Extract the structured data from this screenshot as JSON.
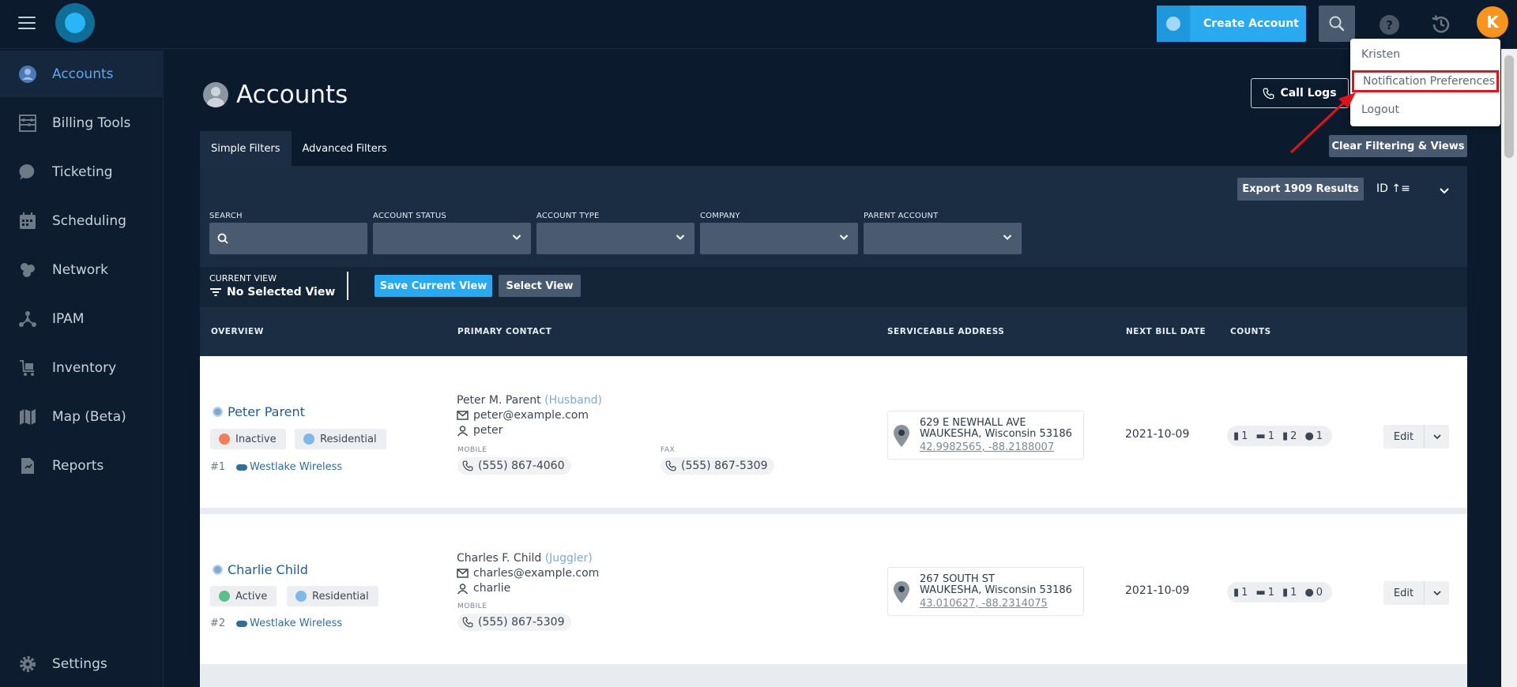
{
  "topbar": {
    "create_account_label": "Create Account",
    "help_label": "?",
    "avatar_initial": "K"
  },
  "user_menu": {
    "items": [
      "Kristen",
      "Notification Preferences",
      "Logout"
    ]
  },
  "sidebar": {
    "items": [
      {
        "label": "Accounts",
        "icon": "account-icon",
        "active": true
      },
      {
        "label": "Billing Tools",
        "icon": "abacus-icon"
      },
      {
        "label": "Ticketing",
        "icon": "chat-icon"
      },
      {
        "label": "Scheduling",
        "icon": "calendar-icon"
      },
      {
        "label": "Network",
        "icon": "network-icon"
      },
      {
        "label": "IPAM",
        "icon": "ipam-icon"
      },
      {
        "label": "Inventory",
        "icon": "cart-icon"
      },
      {
        "label": "Map (Beta)",
        "icon": "map-icon"
      },
      {
        "label": "Reports",
        "icon": "report-icon"
      }
    ],
    "settings_label": "Settings"
  },
  "page": {
    "title": "Accounts",
    "call_logs_label": "Call Logs",
    "clear_label": "Clear Filtering & Views",
    "tabs": [
      "Simple Filters",
      "Advanced Filters"
    ],
    "export_label": "Export 1909 Results",
    "sort_label": "ID ↑≡"
  },
  "filters": [
    {
      "label": "SEARCH",
      "type": "search"
    },
    {
      "label": "ACCOUNT STATUS",
      "type": "select"
    },
    {
      "label": "ACCOUNT TYPE",
      "type": "select"
    },
    {
      "label": "COMPANY",
      "type": "select"
    },
    {
      "label": "PARENT ACCOUNT",
      "type": "select"
    }
  ],
  "view": {
    "current_view_label": "CURRENT VIEW",
    "current_view_value": "No Selected View",
    "save_label": "Save Current View",
    "select_label": "Select View"
  },
  "table": {
    "headers": [
      "OVERVIEW",
      "PRIMARY CONTACT",
      "SERVICEABLE ADDRESS",
      "NEXT BILL DATE",
      "COUNTS"
    ],
    "rows": [
      {
        "name": "Peter Parent",
        "status": "Inactive",
        "status_color": "#f07d5b",
        "type": "Residential",
        "id": "#1",
        "company": "Westlake Wireless",
        "contact_name": "Peter M. Parent",
        "contact_role": "(Husband)",
        "email": "peter@example.com",
        "username": "peter",
        "mobile_label": "MOBILE",
        "mobile": "(555) 867-4060",
        "fax_label": "FAX",
        "fax": "(555) 867-5309",
        "addr1": "629 E NEWHALL AVE",
        "addr2": "WAUKESHA, Wisconsin 53186",
        "coords": "42.9982565, -88.2188007",
        "bill_date": "2021-10-09",
        "counts": [
          "1",
          "1",
          "2",
          "1"
        ],
        "edit_label": "Edit"
      },
      {
        "name": "Charlie Child",
        "status": "Active",
        "status_color": "#5cc08a",
        "type": "Residential",
        "id": "#2",
        "company": "Westlake Wireless",
        "contact_name": "Charles F. Child",
        "contact_role": "(Juggler)",
        "email": "charles@example.com",
        "username": "charlie",
        "mobile_label": "MOBILE",
        "mobile": "(555) 867-5309",
        "addr1": "267 SOUTH ST",
        "addr2": "WAUKESHA, Wisconsin 53186",
        "coords": "43.010627, -88.2314075",
        "bill_date": "2021-10-09",
        "counts": [
          "1",
          "1",
          "1",
          "0"
        ],
        "edit_label": "Edit"
      }
    ]
  },
  "colors": {
    "accent": "#29a9f0",
    "highlight_box": "#e2121b"
  }
}
